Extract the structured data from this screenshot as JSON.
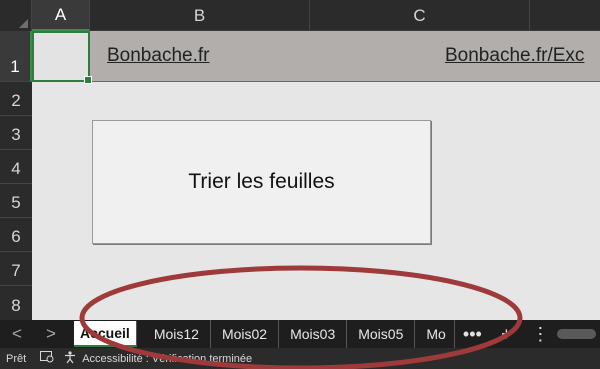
{
  "columns": [
    "A",
    "B",
    "C"
  ],
  "rows": [
    "1",
    "2",
    "3",
    "4",
    "5",
    "6",
    "7",
    "8"
  ],
  "cells": {
    "B1": "Bonbache.fr",
    "C1": "Bonbache.fr/Exc"
  },
  "sort_button": {
    "label": "Trier les feuilles"
  },
  "sheet_tabs": [
    "Accueil",
    "Mois12",
    "Mois02",
    "Mois03",
    "Mois05",
    "Mo"
  ],
  "tab_controls": {
    "prev": "<",
    "next": ">",
    "more": "•••",
    "add": "+",
    "options": "⋮"
  },
  "status": {
    "mode": "Prêt",
    "accessibility": "Accessibilité : Vérification terminée"
  },
  "annotation_color": "#9e3a3a",
  "selection_color": "#2f7d3e"
}
